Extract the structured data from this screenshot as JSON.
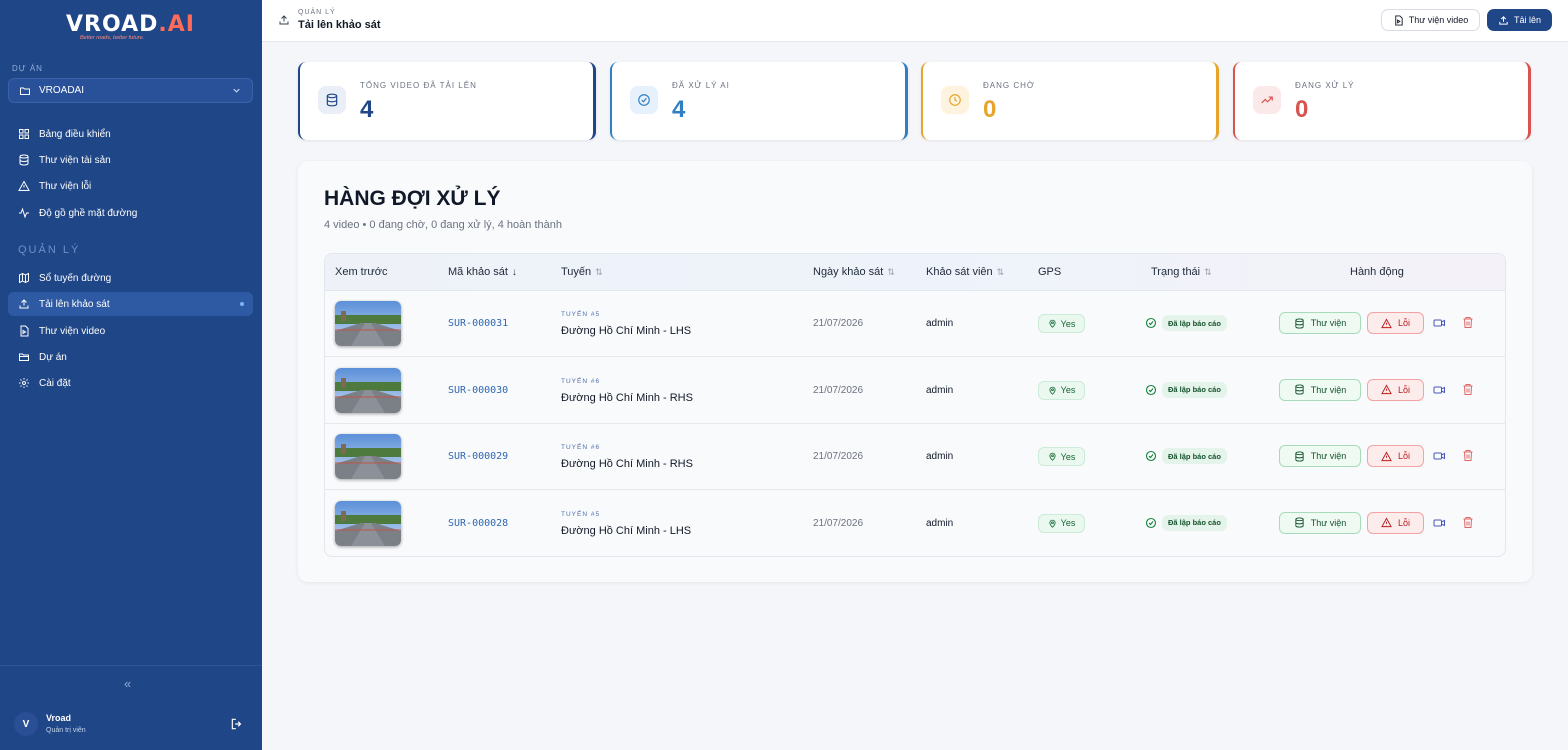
{
  "brand": {
    "name_main": "VROAD",
    "name_suffix": ".AI",
    "tagline": "Better roads, better future."
  },
  "sidebar": {
    "project_label": "DỰ ÁN",
    "project_value": "VROADAI",
    "items": [
      {
        "label": "Bảng điều khiển",
        "icon": "dashboard-icon"
      },
      {
        "label": "Thư viện tài sản",
        "icon": "database-icon"
      },
      {
        "label": "Thư viện lỗi",
        "icon": "warning-icon"
      },
      {
        "label": "Độ gồ ghề mặt đường",
        "icon": "activity-icon"
      }
    ],
    "section_title": "QUẢN LÝ",
    "manage_items": [
      {
        "label": "Sổ tuyến đường",
        "icon": "map-icon"
      },
      {
        "label": "Tải lên khảo sát",
        "icon": "upload-icon",
        "active": true
      },
      {
        "label": "Thư viện video",
        "icon": "file-video-icon"
      },
      {
        "label": "Dự án",
        "icon": "folder-icon"
      },
      {
        "label": "Cài đặt",
        "icon": "gear-icon"
      }
    ],
    "collapse_glyph": "«",
    "user": {
      "initial": "V",
      "name": "Vroad",
      "role": "Quản trị viên"
    }
  },
  "topbar": {
    "breadcrumb_small": "QUẢN LÝ",
    "title": "Tải lên khảo sát",
    "video_library_button": "Thư viện video",
    "upload_button": "Tải lên"
  },
  "stats": [
    {
      "label": "TỔNG VIDEO ĐÃ TẢI LÊN",
      "value": "4",
      "color": "#1f4687"
    },
    {
      "label": "ĐÃ XỬ LÝ AI",
      "value": "4",
      "color": "#2f7fc4"
    },
    {
      "label": "ĐANG CHỜ",
      "value": "0",
      "color": "#e6a52a"
    },
    {
      "label": "ĐANG XỬ LÝ",
      "value": "0",
      "color": "#d9534f"
    }
  ],
  "queue": {
    "title": "HÀNG ĐỢI XỬ LÝ",
    "subtitle": "4 video • 0 đang chờ, 0 đang xử lý, 4 hoàn thành",
    "columns": [
      "Xem trước",
      "Mã khảo sát",
      "Tuyến",
      "Ngày khảo sát",
      "Khảo sát viên",
      "GPS",
      "Trạng thái",
      "Hành động"
    ],
    "rows": [
      {
        "code": "SUR-000031",
        "route_no": "TUYẾN #5",
        "route": "Đường Hồ Chí Minh - LHS",
        "date": "21/07/2026",
        "surveyor": "admin",
        "gps": "Yes",
        "status": "Đã lập báo cáo",
        "lib": "Thư viện",
        "err": "Lỗi"
      },
      {
        "code": "SUR-000030",
        "route_no": "TUYẾN #6",
        "route": "Đường Hồ Chí Minh - RHS",
        "date": "21/07/2026",
        "surveyor": "admin",
        "gps": "Yes",
        "status": "Đã lập báo cáo",
        "lib": "Thư viện",
        "err": "Lỗi"
      },
      {
        "code": "SUR-000029",
        "route_no": "TUYẾN #6",
        "route": "Đường Hồ Chí Minh - RHS",
        "date": "21/07/2026",
        "surveyor": "admin",
        "gps": "Yes",
        "status": "Đã lập báo cáo",
        "lib": "Thư viện",
        "err": "Lỗi"
      },
      {
        "code": "SUR-000028",
        "route_no": "TUYẾN #5",
        "route": "Đường Hồ Chí Minh - LHS",
        "date": "21/07/2026",
        "surveyor": "admin",
        "gps": "Yes",
        "status": "Đã lập báo cáo",
        "lib": "Thư viện",
        "err": "Lỗi"
      }
    ]
  }
}
